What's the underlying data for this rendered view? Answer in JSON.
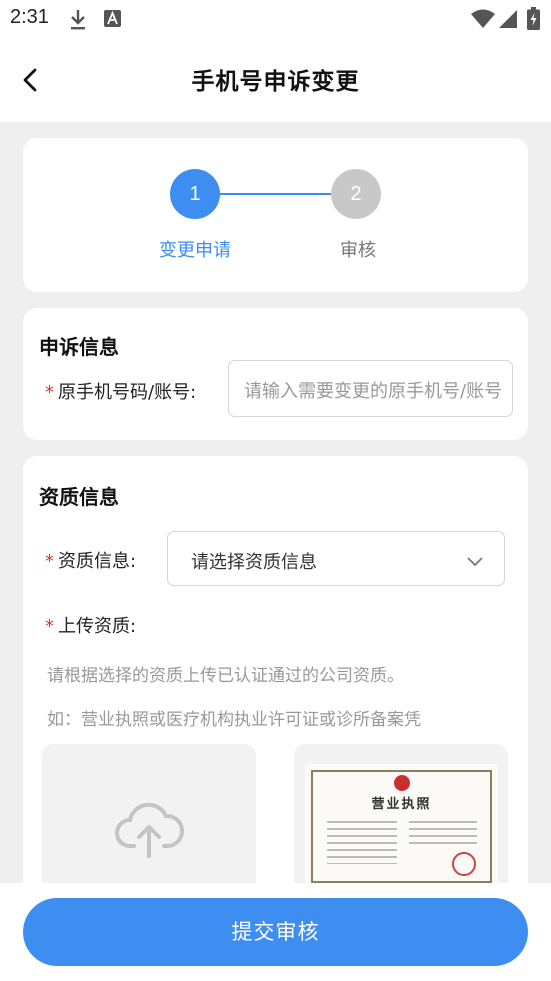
{
  "status_bar": {
    "time": "2:31",
    "icons": [
      "download-icon",
      "text-a-icon",
      "wifi-icon",
      "signal-icon",
      "battery-charging-icon"
    ]
  },
  "nav": {
    "back_icon": "chevron-left-icon",
    "title": "手机号申诉变更"
  },
  "steps": [
    {
      "number": "1",
      "label": "变更申请",
      "active": true
    },
    {
      "number": "2",
      "label": "审核",
      "active": false
    }
  ],
  "appeal": {
    "title": "申诉信息",
    "required_mark": "*",
    "phone_label": "原手机号码/账号:",
    "phone_placeholder": "请输入需要变更的原手机号/账号"
  },
  "qualification": {
    "title": "资质信息",
    "required_mark": "*",
    "type_label": "资质信息:",
    "type_placeholder": "请选择资质信息",
    "upload_label": "上传资质:",
    "hint_1": "请根据选择的资质上传已认证通过的公司资质。",
    "hint_2": "如：营业执照或医疗机构执业许可证或诊所备案凭",
    "upload_icon": "cloud-upload-icon",
    "sample_title": "营业执照"
  },
  "footer": {
    "submit_label": "提交审核"
  },
  "colors": {
    "accent": "#3d8ef0",
    "inactive_step": "#c8c8c8",
    "required": "#e0302a",
    "background": "#efefef"
  }
}
